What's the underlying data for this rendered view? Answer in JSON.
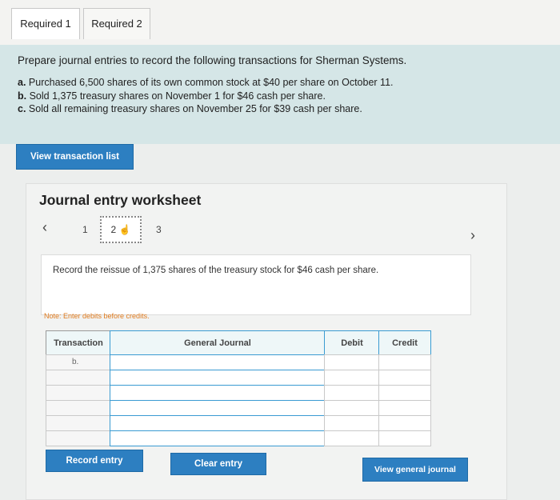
{
  "tabs": [
    "Required 1",
    "Required 2"
  ],
  "intro": "Prepare journal entries to record the following transactions for Sherman Systems.",
  "transactions": [
    {
      "letter": "a.",
      "text": "Purchased 6,500 shares of its own common stock at $40 per share on October 11."
    },
    {
      "letter": "b.",
      "text": "Sold 1,375 treasury shares on November 1 for $46 cash per share."
    },
    {
      "letter": "c.",
      "text": "Sold all remaining treasury shares on November 25 for $39 cash per share."
    }
  ],
  "view_transaction_list": "View transaction list",
  "worksheet": {
    "title": "Journal entry worksheet",
    "pages": [
      "1",
      "2",
      "3"
    ],
    "description": "Record the reissue of 1,375 shares of the treasury stock for $46 cash per share.",
    "note": "Note: Enter debits before credits.",
    "columns": [
      "Transaction",
      "General Journal",
      "Debit",
      "Credit"
    ],
    "first_transaction": "b.",
    "record_entry": "Record entry",
    "clear_entry": "Clear entry",
    "view_general_journal": "View general journal"
  }
}
